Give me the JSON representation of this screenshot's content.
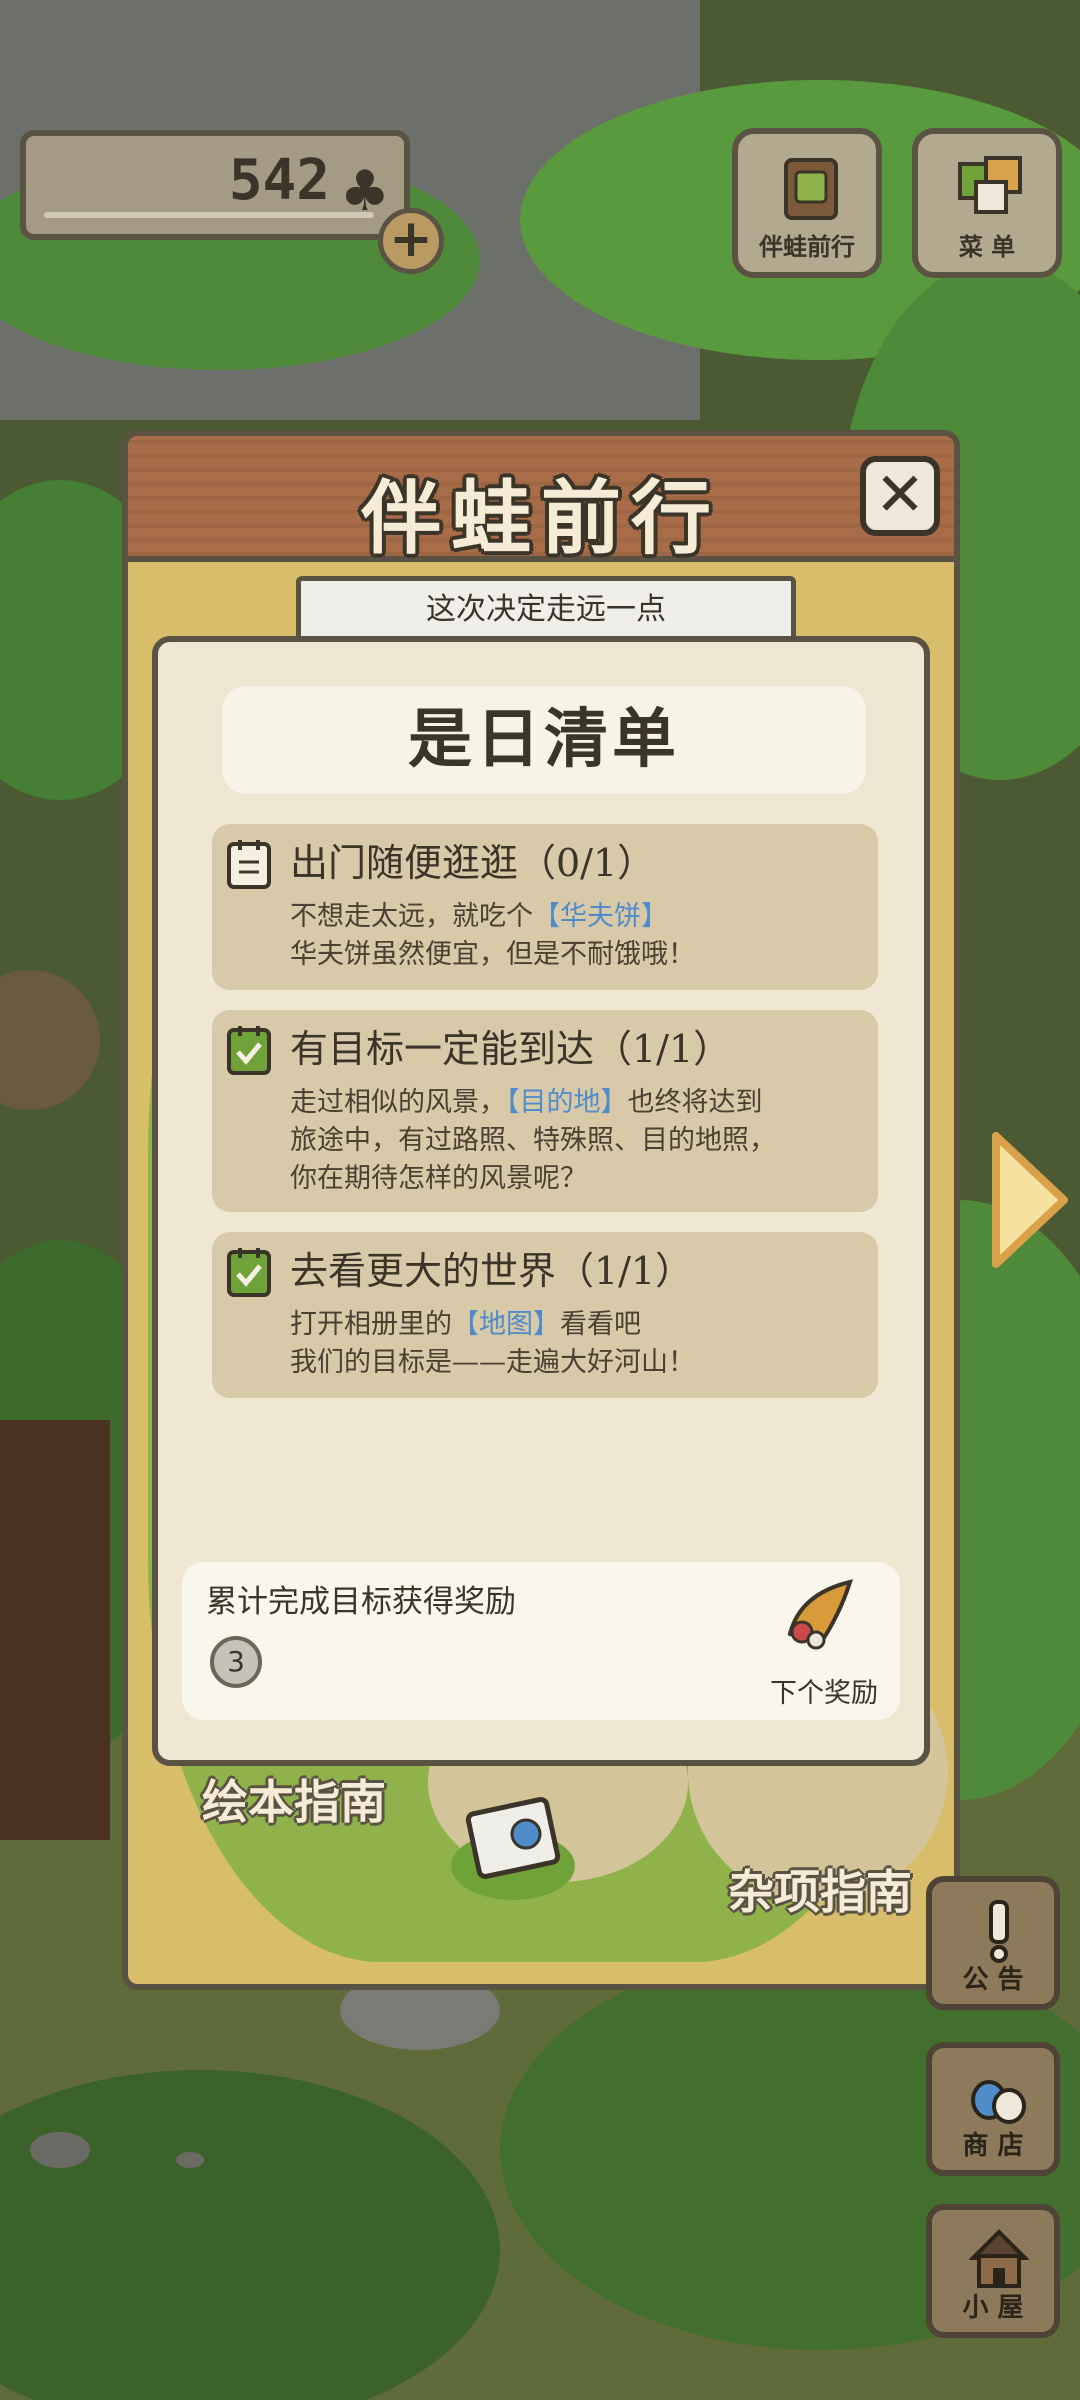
{
  "hud": {
    "clover_count": "542",
    "clover_symbol": "♣",
    "add_label": "+",
    "buttons": [
      {
        "label": "伴蛙前行"
      },
      {
        "label": "菜 单"
      }
    ]
  },
  "panel": {
    "title": "伴蛙前行",
    "close_label": "✕",
    "banner": "这次决定走远一点",
    "guide_left": "绘本指南",
    "guide_right": "杂项指南"
  },
  "checklist": {
    "title": "是日清单",
    "tasks": [
      {
        "title": "出门随便逛逛（0/1）",
        "line1_pre": "不想走太远，就吃个",
        "line1_hl": "【华夫饼】",
        "line1_post": "",
        "line2": "华夫饼虽然便宜，但是不耐饿哦！",
        "line3": "",
        "completed": false
      },
      {
        "title": "有目标一定能到达（1/1）",
        "line1_pre": "走过相似的风景，",
        "line1_hl": "【目的地】",
        "line1_post": "也终将达到",
        "line2": "旅途中，有过路照、特殊照、目的地照，",
        "line3": "你在期待怎样的风景呢？",
        "completed": true
      },
      {
        "title": "去看更大的世界（1/1）",
        "line1_pre": "打开相册里的",
        "line1_hl": "【地图】",
        "line1_post": "看看吧",
        "line2": "我们的目标是——走遍大好河山！",
        "line3": "",
        "completed": true
      }
    ],
    "reward": {
      "label": "累计完成目标获得奖励",
      "count": "3",
      "next_label": "下个奖励"
    }
  },
  "side": {
    "notice": "公 告",
    "shop": "商 店",
    "house": "小 屋"
  },
  "colors": {
    "panel_yellow": "#d8bd6b",
    "wood_header": "#a86d48",
    "card_bg": "#efe7d2",
    "task_bg": "#d8c9a8",
    "check_green": "#6fa33a",
    "highlight_blue": "#4f8cc9"
  }
}
